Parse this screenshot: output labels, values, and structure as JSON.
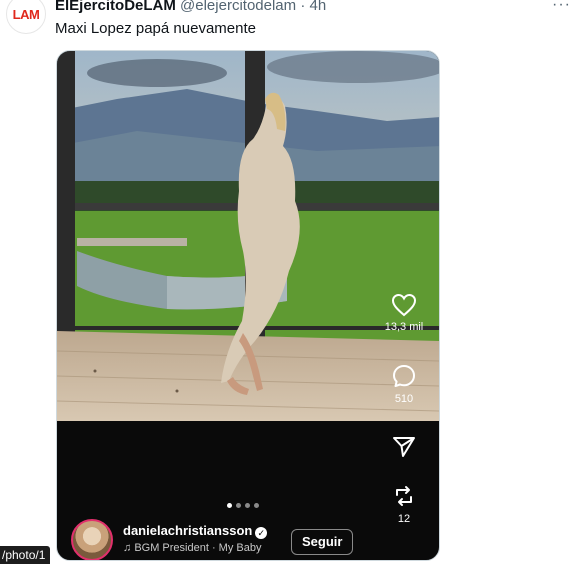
{
  "tweet": {
    "avatar_text": "LAM",
    "display_name": "ElEjercitoDeLAM",
    "handle": "@elejercitodelam",
    "separator": "·",
    "time": "4h",
    "text": "Maxi Lopez papá nuevamente"
  },
  "media": {
    "actions": {
      "likes": "13,3 mil",
      "comments": "510",
      "reposts": "12"
    },
    "carousel": {
      "total": 4,
      "active": 1
    },
    "profile": {
      "username": "danielachristiansson",
      "music": "BGM President · My Baby",
      "follow_label": "Seguir"
    }
  },
  "status": {
    "photo_path": "/photo/1"
  },
  "colors": {
    "accent_red": "#e0281c",
    "story_ring": "#e1306c"
  }
}
